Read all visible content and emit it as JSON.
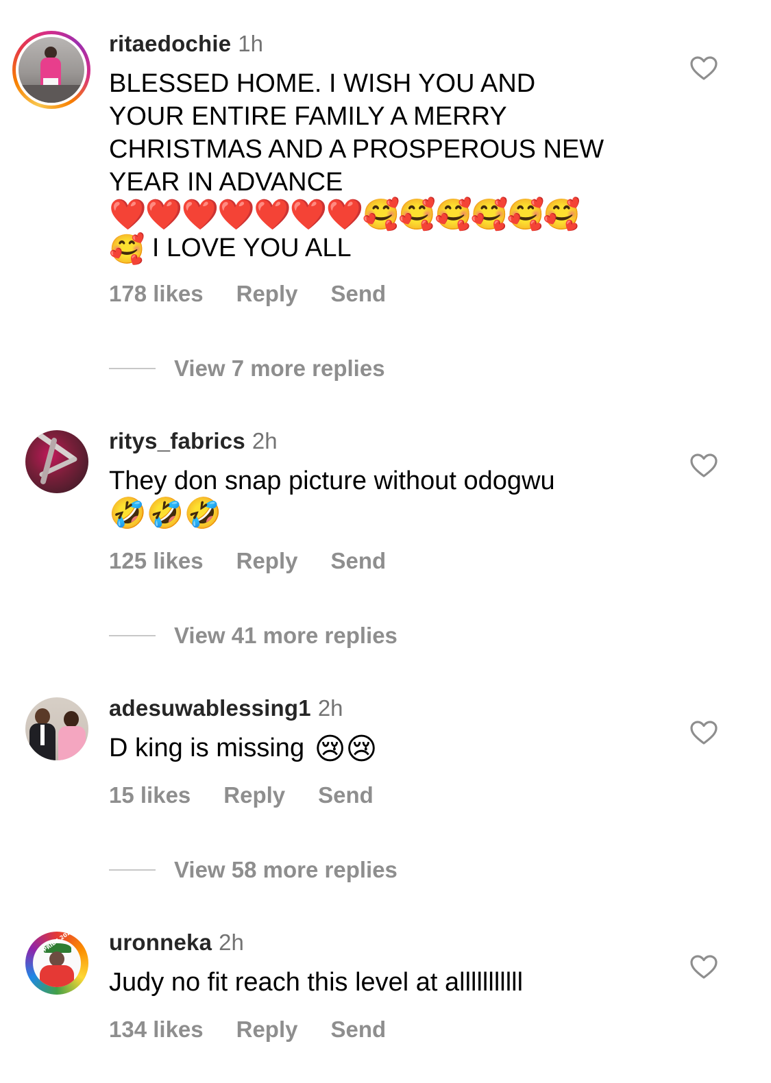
{
  "comments": [
    {
      "username": "ritaedochie",
      "time": "1h",
      "text_lines": [
        "BLESSED HOME.  I WISH YOU AND",
        "YOUR ENTIRE FAMILY A MERRY",
        "CHRISTMAS AND A PROSPEROUS NEW",
        "YEAR  IN ADVANCE"
      ],
      "emoji_line": "❤️❤️❤️❤️❤️❤️❤️🥰🥰🥰🥰🥰🥰",
      "last_line_emoji": "🥰",
      "last_line_text": " I LOVE YOU ALL",
      "likes": "178 likes",
      "reply": "Reply",
      "send": "Send",
      "view_replies": "View 7 more replies",
      "avatar": "story-ring"
    },
    {
      "username": "ritys_fabrics",
      "time": "2h",
      "text_lines": [
        "They don snap picture without odogwu"
      ],
      "emoji_line": "🤣🤣🤣",
      "likes": "125 likes",
      "reply": "Reply",
      "send": "Send",
      "view_replies": "View 41 more replies",
      "avatar": "plain"
    },
    {
      "username": "adesuwablessing1",
      "time": "2h",
      "text": "D king is missing",
      "emoji": "😢😢",
      "likes": "15 likes",
      "reply": "Reply",
      "send": "Send",
      "view_replies": "View 58 more replies",
      "avatar": "plain"
    },
    {
      "username": "uronneka",
      "time": "2h",
      "text": "Judy no fit reach this level at alllllllllll",
      "likes": "134 likes",
      "reply": "Reply",
      "send": "Send",
      "avatar": "rainbow-ring",
      "avatar_badge": "PRIDE 2022"
    }
  ],
  "icons": {
    "like": "heart-outline-icon",
    "reply_divider": "dash-line"
  },
  "colors": {
    "text": "#000000",
    "username": "#262626",
    "secondary": "#8e8e8e",
    "timestamp": "#737373",
    "divider": "#c7c7c7"
  }
}
